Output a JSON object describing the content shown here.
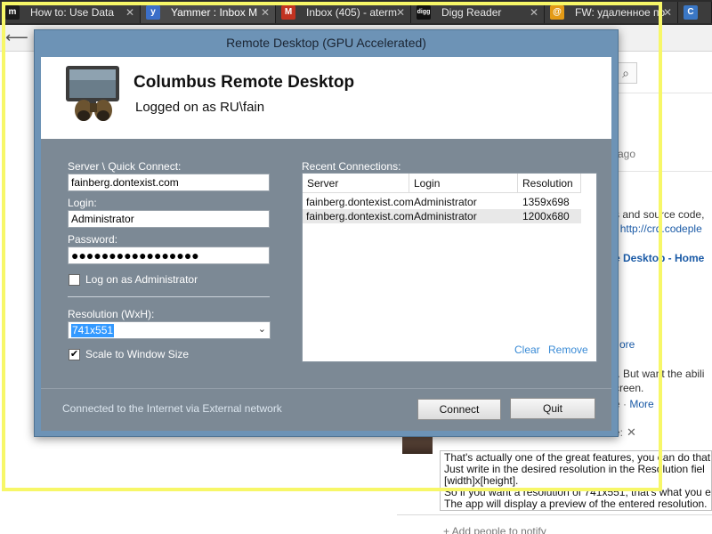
{
  "browser": {
    "tabs": [
      {
        "title": "How to: Use Data",
        "favicon": "m",
        "fav_color": "#1c1c1c"
      },
      {
        "title": "Yammer : Inbox M",
        "favicon": "y",
        "fav_color": "#3b6fc9"
      },
      {
        "title": "Inbox (405) - aterm",
        "favicon": "M",
        "fav_color": "#c23321"
      },
      {
        "title": "Digg Reader",
        "favicon": "digg",
        "fav_color": "#111111"
      },
      {
        "title": "FW: удаленное по",
        "favicon": "@",
        "fav_color": "#e39a16"
      },
      {
        "title": "C",
        "favicon": "C",
        "fav_color": "#3a77c5"
      }
    ],
    "back_icon": "back-arrow-icon"
  },
  "background_page": {
    "ago": "ago",
    "line1": "s and source code,",
    "line1_link_prefix": "t",
    "line1_link": "http://crd.codeple",
    "desktop_home": "e Desktop - Home",
    "more1": "ore",
    "line2": "t. But want the abili",
    "line3": "creen.",
    "line4_sep": "e ·",
    "line4_more": "More",
    "comment": [
      "That's actually one of the great features, you can do that",
      "Just write in the desired resolution in the Resolution fiel",
      "[width]x[height].",
      "So if you want a resolution of 741x551, that's what you e",
      "The app will display a preview of the entered resolution."
    ],
    "add_people": "+ Add people to notify",
    "colon": "e:"
  },
  "dialog": {
    "title": "Remote Desktop (GPU Accelerated)",
    "app_title": "Columbus Remote Desktop",
    "logged_on": "Logged on as RU\\fain",
    "server_label": "Server \\ Quick Connect:",
    "server_value": "fainberg.dontexist.com",
    "login_label": "Login:",
    "login_value": "Administrator",
    "password_label": "Password:",
    "password_value": "●●●●●●●●●●●●●●●●●",
    "admin_label": "Log on as Administrator",
    "admin_checked": false,
    "resolution_label": "Resolution (WxH):",
    "resolution_value": "741x551",
    "scale_label": "Scale to Window Size",
    "scale_checked": true,
    "check_mark": "✔",
    "recent_label": "Recent Connections:",
    "recent_columns": [
      "Server",
      "Login",
      "Resolution"
    ],
    "recent_rows": [
      {
        "server": "fainberg.dontexist.com",
        "login": "Administrator",
        "resolution": "1359x698"
      },
      {
        "server": "fainberg.dontexist.com",
        "login": "Administrator",
        "resolution": "1200x680"
      }
    ],
    "clear_label": "Clear",
    "remove_label": "Remove",
    "status_text": "Connected to the Internet via External network",
    "connect_label": "Connect",
    "quit_label": "Quit"
  },
  "colors": {
    "dialog_frame": "#6d93b6",
    "dialog_body": "#7c8995",
    "link_blue": "#3a8bd6",
    "highlight_frame": "#f7f768"
  }
}
